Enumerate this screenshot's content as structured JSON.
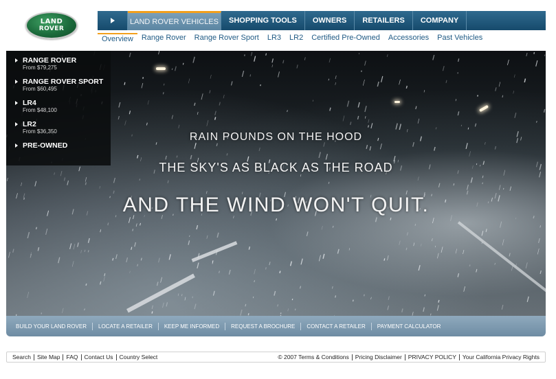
{
  "logo": {
    "line1": "LAND",
    "line2": "ROVER"
  },
  "topnav": {
    "tabs": [
      {
        "label": "LAND ROVER VEHICLES"
      },
      {
        "label": "SHOPPING TOOLS"
      },
      {
        "label": "OWNERS"
      },
      {
        "label": "RETAILERS"
      },
      {
        "label": "COMPANY"
      }
    ]
  },
  "subnav": {
    "items": [
      {
        "label": "Overview"
      },
      {
        "label": "Range Rover"
      },
      {
        "label": "Range Rover Sport"
      },
      {
        "label": "LR3"
      },
      {
        "label": "LR2"
      },
      {
        "label": "Certified Pre-Owned"
      },
      {
        "label": "Accessories"
      },
      {
        "label": "Past Vehicles"
      }
    ]
  },
  "vehicle_menu": [
    {
      "name": "RANGE ROVER",
      "price": "From $79,275"
    },
    {
      "name": "RANGE ROVER SPORT",
      "price": "From $60,495"
    },
    {
      "name": "LR4",
      "price": "From $48,100"
    },
    {
      "name": "LR2",
      "price": "From $36,350"
    },
    {
      "name": "PRE-OWNED",
      "price": ""
    }
  ],
  "hero": {
    "line1": "RAIN POUNDS ON THE HOOD",
    "line2": "THE SKY'S AS BLACK AS THE ROAD",
    "line3": "AND THE WIND WON'T QUIT."
  },
  "actionbar": {
    "items": [
      {
        "label": "BUILD YOUR LAND ROVER"
      },
      {
        "label": "LOCATE A RETAILER"
      },
      {
        "label": "KEEP ME INFORMED"
      },
      {
        "label": "REQUEST A BROCHURE"
      },
      {
        "label": "CONTACT A RETAILER"
      },
      {
        "label": "PAYMENT CALCULATOR"
      }
    ]
  },
  "footer": {
    "left": [
      {
        "label": "Search"
      },
      {
        "label": "Site Map"
      },
      {
        "label": "FAQ"
      },
      {
        "label": "Contact Us"
      },
      {
        "label": "Country Select"
      }
    ],
    "right": [
      {
        "label": "© 2007 Terms & Conditions"
      },
      {
        "label": "Pricing Disclaimer"
      },
      {
        "label": "PRIVACY POLICY"
      },
      {
        "label": "Your California Privacy Rights"
      }
    ]
  },
  "colors": {
    "nav_blue": "#164a6c",
    "accent_orange": "#f2a01c",
    "subnav_link": "#1f5a84",
    "brand_green": "#1c6b3c"
  }
}
